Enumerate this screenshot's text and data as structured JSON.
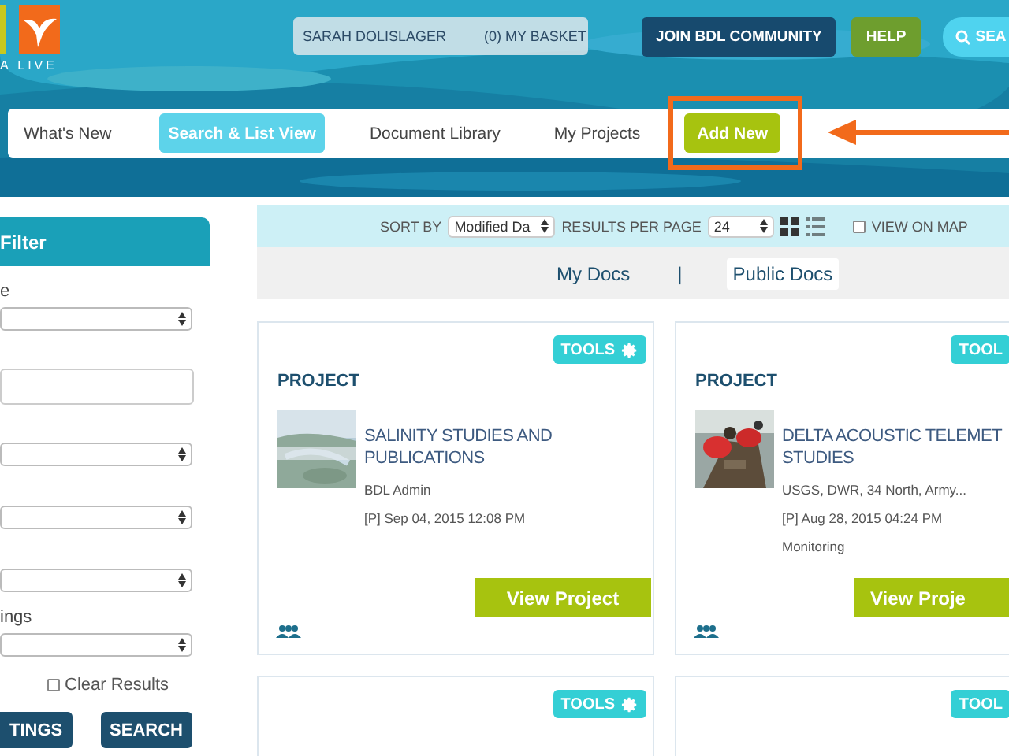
{
  "header": {
    "logo_text": "A LIVE",
    "user": "SARAH DOLISLAGER",
    "basket": "(0) MY BASKET",
    "join_button": "JOIN BDL COMMUNITY",
    "help_button": "HELP",
    "search_button": "SEA"
  },
  "nav": {
    "tabs": [
      {
        "label": "What's New",
        "selected": false,
        "kind": "link",
        "highlighted": false
      },
      {
        "label": "Search & List View",
        "selected": true,
        "kind": "link",
        "highlighted": false
      },
      {
        "label": "Document Library",
        "selected": false,
        "kind": "link",
        "highlighted": false
      },
      {
        "label": "My Projects",
        "selected": false,
        "kind": "link",
        "highlighted": false
      },
      {
        "label": "Add New",
        "selected": false,
        "kind": "action",
        "highlighted": true
      }
    ]
  },
  "sidebar": {
    "title": "Filter",
    "fields": [
      {
        "kind": "select",
        "label": "e"
      },
      {
        "kind": "input"
      },
      {
        "kind": "select"
      },
      {
        "kind": "select"
      },
      {
        "kind": "select"
      },
      {
        "kind": "select",
        "label": "ings"
      }
    ],
    "clear_results": {
      "label": "Clear Results",
      "checked": false
    },
    "buttons": [
      "TINGS",
      "SEARCH"
    ]
  },
  "toolbar": {
    "sort_label": "SORT BY",
    "sort_value": "Modified Da",
    "per_page_label": "RESULTS PER PAGE",
    "per_page_value": "24",
    "views": [
      {
        "kind": "grid",
        "selected": true
      },
      {
        "kind": "list",
        "selected": false
      }
    ],
    "view_on_map": {
      "label": "VIEW ON MAP",
      "checked": false
    }
  },
  "doc_tabs": {
    "tabs": [
      {
        "label": "My Docs",
        "selected": false
      },
      {
        "label": "Public Docs",
        "selected": true
      }
    ],
    "separator": "|"
  },
  "cards": [
    {
      "type": "PROJECT",
      "tools": "TOOLS",
      "title": "SALINITY STUDIES AND PUBLICATIONS",
      "meta": [
        "BDL Admin",
        "[P] Sep 04, 2015 12:08 PM"
      ],
      "button": "View Project"
    },
    {
      "type": "PROJECT",
      "tools": "TOOL",
      "title": "DELTA ACOUSTIC TELEMET STUDIES",
      "meta": [
        "USGS, DWR, 34 North, Army...",
        "[P] Aug 28, 2015 04:24 PM",
        "Monitoring"
      ],
      "button": "View Proje"
    },
    {
      "tools": "TOOLS"
    },
    {
      "tools": "TOOL"
    }
  ]
}
